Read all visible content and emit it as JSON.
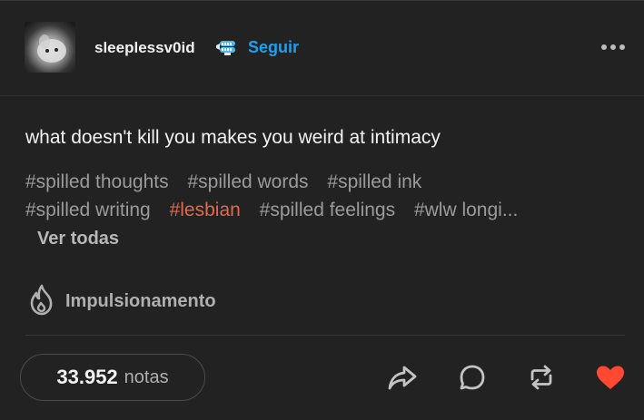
{
  "post": {
    "username": "sleeplessv0id",
    "follow_label": "Seguir",
    "text": "what doesn't kill you makes you weird at intimacy",
    "tags_row1": [
      "#spilled thoughts",
      "#spilled words",
      "#spilled ink"
    ],
    "tags_row2": [
      "#spilled writing",
      "#lesbian",
      "#spilled feelings",
      "#wlw longi..."
    ],
    "view_all_label": "Ver todas",
    "boost_label": "Impulsionamento",
    "notes_count": "33.952",
    "notes_label": "notas"
  },
  "icons": {
    "badge": "chattering-teeth-icon",
    "more": "more-options-icon",
    "boost": "flame-icon",
    "share": "share-icon",
    "reply": "reply-icon",
    "reblog": "reblog-icon",
    "like": "heart-icon"
  },
  "colors": {
    "background": "#222222",
    "follow": "#1ea0f2",
    "tag": "#9b9b9b",
    "tag_lesbian": "#e06a4a",
    "like": "#ff4930"
  }
}
